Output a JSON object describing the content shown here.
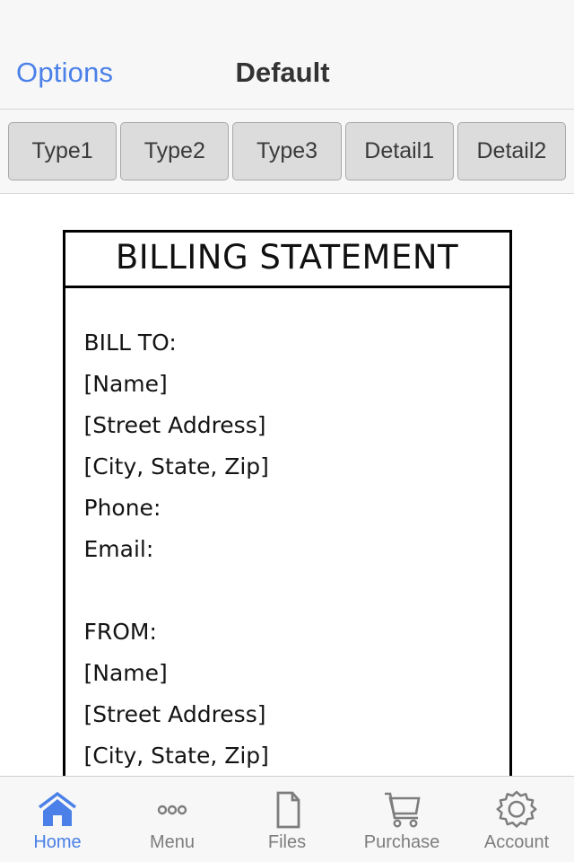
{
  "colors": {
    "accent": "#4a80e8",
    "inactive": "#7d7d7d",
    "chrome_bg": "#f7f7f7",
    "segment_fill": "#dcdcdc",
    "doc_border": "#000000"
  },
  "header": {
    "options_label": "Options",
    "title": "Default"
  },
  "segmented_control": {
    "items": [
      {
        "label": "Type1"
      },
      {
        "label": "Type2"
      },
      {
        "label": "Type3"
      },
      {
        "label": "Detail1"
      },
      {
        "label": "Detail2"
      }
    ]
  },
  "document": {
    "title": "BILLING STATEMENT",
    "lines": [
      {
        "text": "BILL TO:",
        "kind": "text"
      },
      {
        "text": "[Name]",
        "kind": "text"
      },
      {
        "text": "[Street Address]",
        "kind": "text"
      },
      {
        "text": "[City, State, Zip]",
        "kind": "text"
      },
      {
        "text": "Phone:",
        "kind": "text"
      },
      {
        "text": "Email:",
        "kind": "text"
      },
      {
        "text": "",
        "kind": "spacer"
      },
      {
        "text": "FROM:",
        "kind": "text"
      },
      {
        "text": "[Name]",
        "kind": "text"
      },
      {
        "text": "[Street Address]",
        "kind": "text"
      },
      {
        "text": "[City, State, Zip]",
        "kind": "text"
      }
    ]
  },
  "tab_bar": {
    "items": [
      {
        "label": "Home",
        "icon": "home-icon",
        "active": true
      },
      {
        "label": "Menu",
        "icon": "ellipsis-icon",
        "active": false
      },
      {
        "label": "Files",
        "icon": "document-icon",
        "active": false
      },
      {
        "label": "Purchase",
        "icon": "shopping-cart-icon",
        "active": false
      },
      {
        "label": "Account",
        "icon": "gear-icon",
        "active": false
      }
    ]
  }
}
